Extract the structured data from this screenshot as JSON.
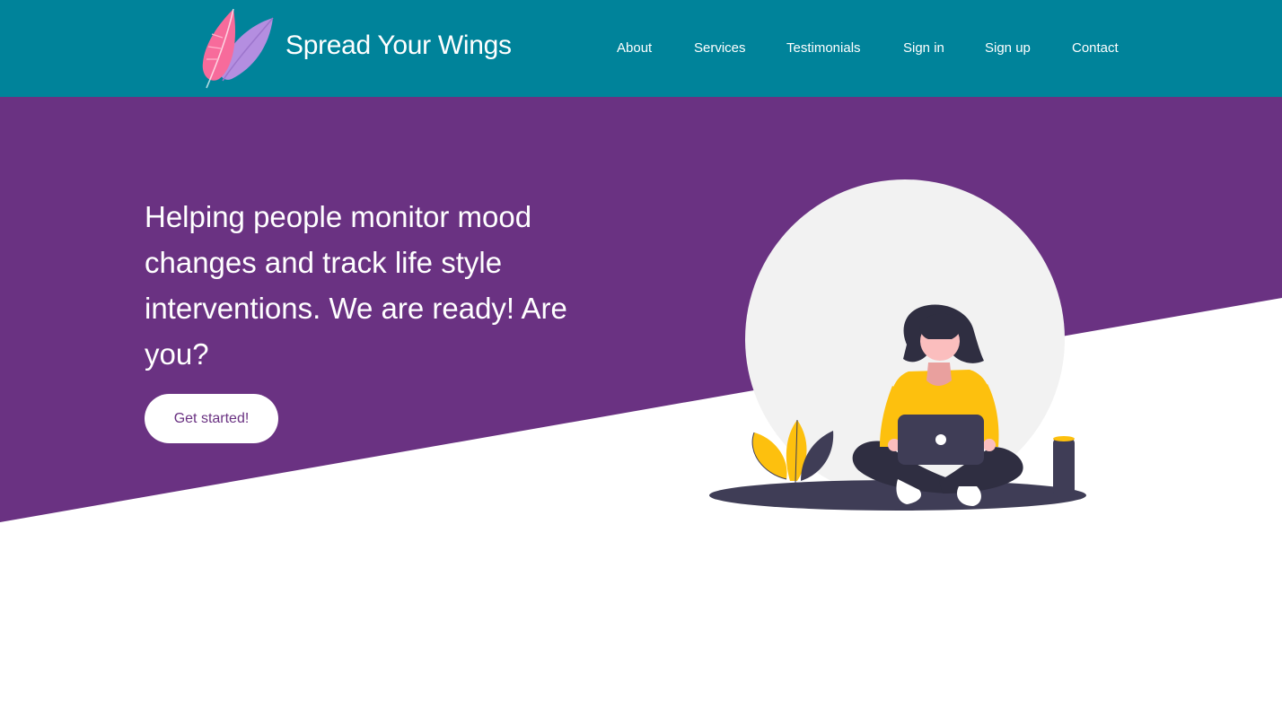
{
  "header": {
    "brand_name": "Spread Your Wings",
    "logo_icon": "feather-icon",
    "nav": [
      "About",
      "Services",
      "Testimonials",
      "Sign in",
      "Sign up",
      "Contact"
    ]
  },
  "hero": {
    "title": "Helping people monitor mood changes and track life style interventions. We are ready! Are you?",
    "cta_label": "Get started!",
    "illustration_icon": "woman-with-laptop-illustration"
  },
  "colors": {
    "navbar": "#00839a",
    "hero": "#6a3282",
    "accent": "#fdc00e",
    "feather_pink": "#f76b9b",
    "feather_lilac": "#b48ee0"
  }
}
